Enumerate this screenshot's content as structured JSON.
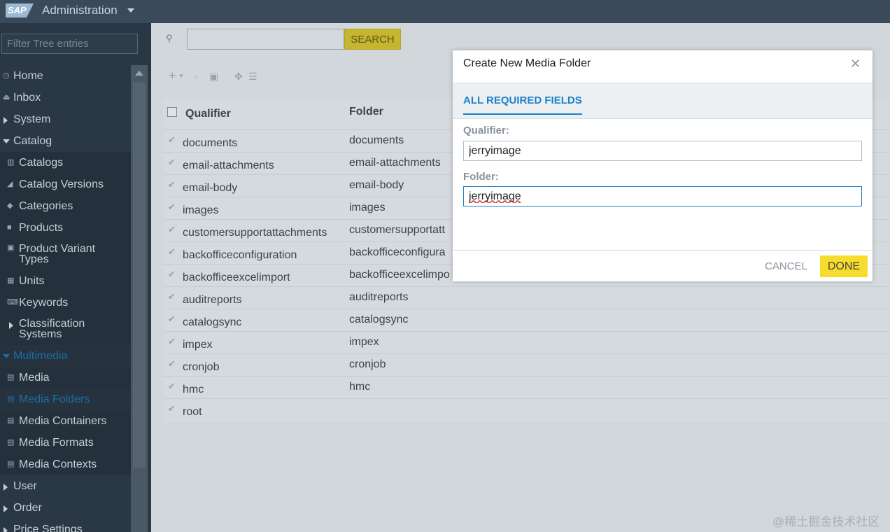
{
  "app": {
    "logo_text": "SAP",
    "title": "Administration"
  },
  "sidebar": {
    "filter_placeholder": "Filter Tree entries",
    "items": [
      {
        "label": "Home",
        "icon": "clock-icon"
      },
      {
        "label": "Inbox",
        "icon": "tray-icon"
      },
      {
        "label": "System",
        "icon": "caret-right-icon"
      },
      {
        "label": "Catalog",
        "icon": "caret-down-icon"
      },
      {
        "label": "Catalogs",
        "icon": "catalog-icon"
      },
      {
        "label": "Catalog Versions",
        "icon": "versions-icon"
      },
      {
        "label": "Categories",
        "icon": "tag-icon"
      },
      {
        "label": "Products",
        "icon": "cube-icon"
      },
      {
        "label": "Product Variant Types",
        "icon": "variant-icon"
      },
      {
        "label": "Units",
        "icon": "units-icon"
      },
      {
        "label": "Keywords",
        "icon": "keyboard-icon"
      },
      {
        "label": "Classification Systems",
        "icon": "caret-right-icon"
      },
      {
        "label": "Multimedia",
        "icon": "caret-down-icon"
      },
      {
        "label": "Media",
        "icon": "media-icon"
      },
      {
        "label": "Media Folders",
        "icon": "folder-icon"
      },
      {
        "label": "Media Containers",
        "icon": "container-icon"
      },
      {
        "label": "Media Formats",
        "icon": "format-icon"
      },
      {
        "label": "Media Contexts",
        "icon": "context-icon"
      },
      {
        "label": "User",
        "icon": "caret-right-icon"
      },
      {
        "label": "Order",
        "icon": "caret-right-icon"
      },
      {
        "label": "Price Settings",
        "icon": "caret-right-icon"
      }
    ]
  },
  "search": {
    "button_label": "SEARCH",
    "value": ""
  },
  "grid": {
    "columns": [
      "Qualifier",
      "Folder"
    ],
    "rows": [
      {
        "qualifier": "documents",
        "folder": "documents"
      },
      {
        "qualifier": "email-attachments",
        "folder": "email-attachments"
      },
      {
        "qualifier": "email-body",
        "folder": "email-body"
      },
      {
        "qualifier": "images",
        "folder": "images"
      },
      {
        "qualifier": "customersupportattachments",
        "folder": "customersupportatt"
      },
      {
        "qualifier": "backofficeconfiguration",
        "folder": "backofficeconfigura"
      },
      {
        "qualifier": "backofficeexcelimport",
        "folder": "backofficeexcelimpo"
      },
      {
        "qualifier": "auditreports",
        "folder": "auditreports"
      },
      {
        "qualifier": "catalogsync",
        "folder": "catalogsync"
      },
      {
        "qualifier": "impex",
        "folder": "impex"
      },
      {
        "qualifier": "cronjob",
        "folder": "cronjob"
      },
      {
        "qualifier": "hmc",
        "folder": "hmc"
      },
      {
        "qualifier": "root",
        "folder": ""
      }
    ]
  },
  "dialog": {
    "title": "Create New Media Folder",
    "tab": "ALL REQUIRED FIELDS",
    "qualifier_label": "Qualifier:",
    "qualifier_value": "jerryimage",
    "folder_label": "Folder:",
    "folder_value": "jerryimage",
    "cancel_label": "CANCEL",
    "done_label": "DONE",
    "done_color": "#f7dc2d",
    "accent_color": "#1b82c6"
  },
  "watermark": "@稀土掘金技术社区"
}
